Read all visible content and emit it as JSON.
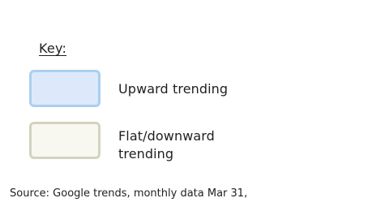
{
  "key": {
    "title": "Key:",
    "items": [
      {
        "label": "Upward trending",
        "fill_color": "#dde9fa",
        "border_color": "#aacff0"
      },
      {
        "label": "Flat/downward trending",
        "fill_color": "#f8f8f1",
        "border_color": "#d3d3bf"
      }
    ]
  },
  "source": "Source: Google trends, monthly data Mar 31,"
}
